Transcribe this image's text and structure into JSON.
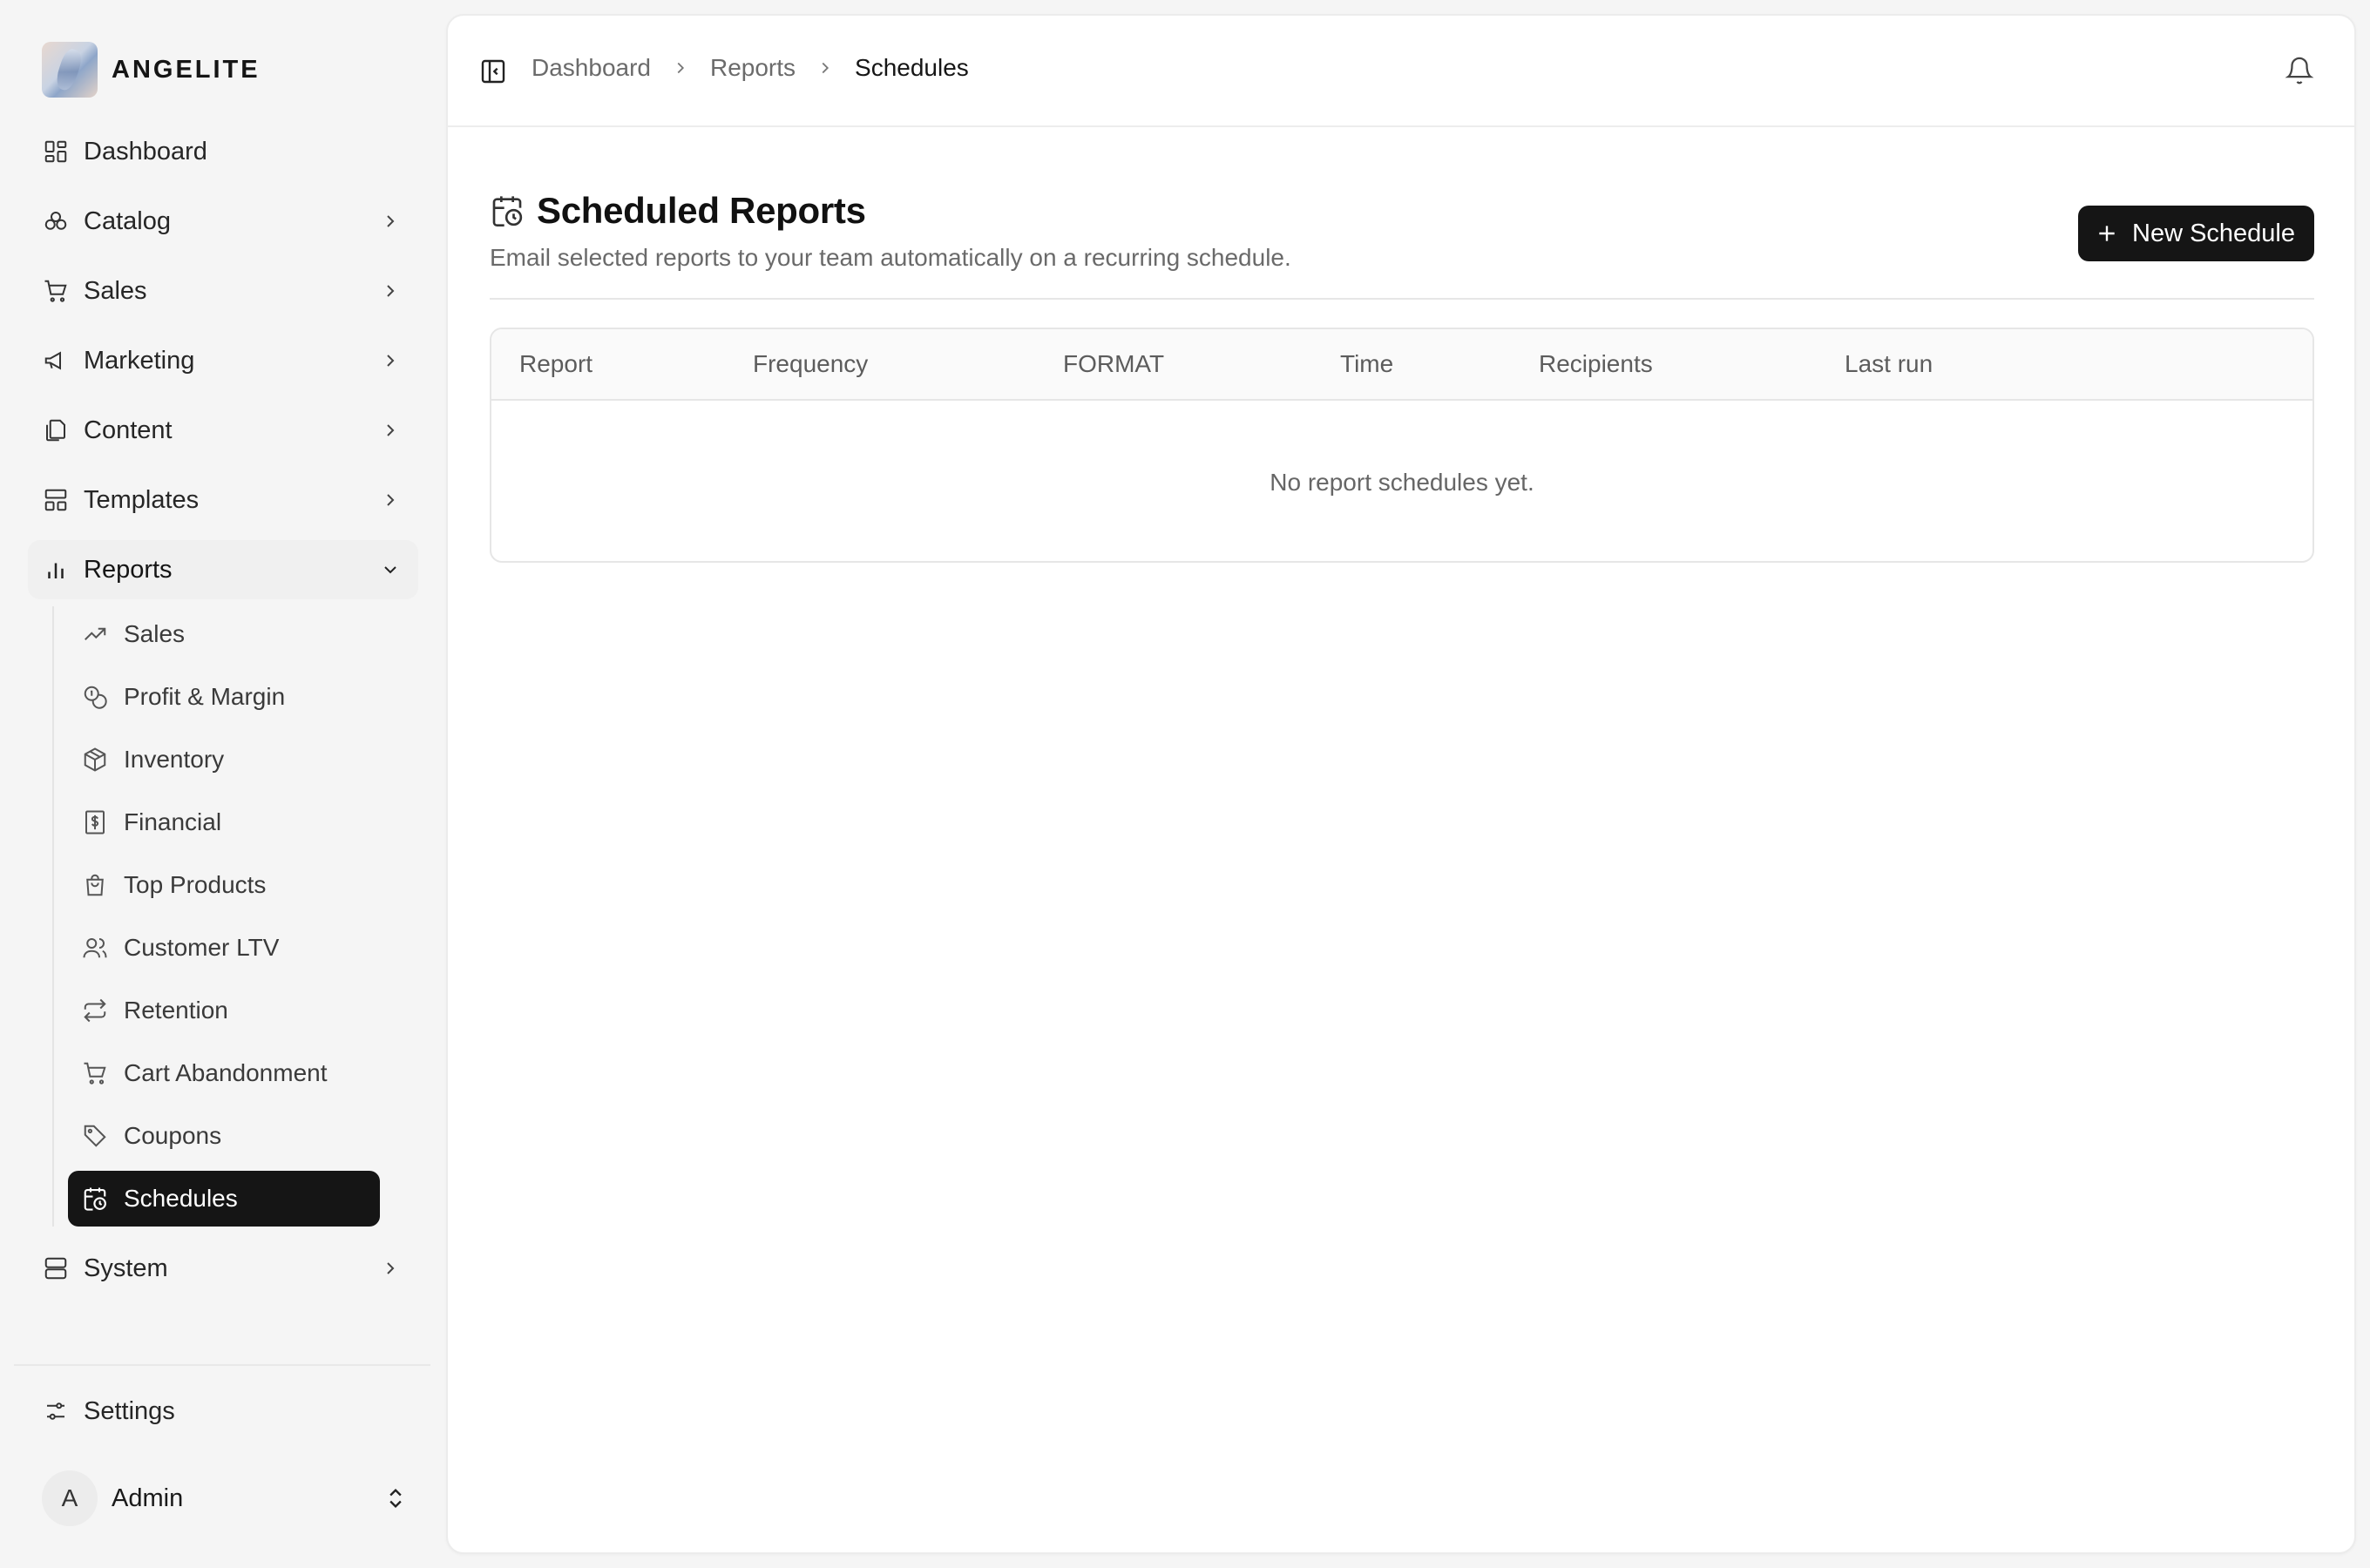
{
  "brand": {
    "name": "ANGELITE"
  },
  "sidebar": {
    "items": [
      {
        "label": "Dashboard",
        "icon": "dashboard-icon",
        "has_chevron": false
      },
      {
        "label": "Catalog",
        "icon": "catalog-icon",
        "has_chevron": true
      },
      {
        "label": "Sales",
        "icon": "cart-icon",
        "has_chevron": true
      },
      {
        "label": "Marketing",
        "icon": "megaphone-icon",
        "has_chevron": true
      },
      {
        "label": "Content",
        "icon": "files-icon",
        "has_chevron": true
      },
      {
        "label": "Templates",
        "icon": "layout-icon",
        "has_chevron": true
      },
      {
        "label": "Reports",
        "icon": "bar-chart-icon",
        "expanded": true
      }
    ],
    "reports_sub": [
      {
        "label": "Sales",
        "icon": "trend-up-icon"
      },
      {
        "label": "Profit & Margin",
        "icon": "coins-icon"
      },
      {
        "label": "Inventory",
        "icon": "package-icon"
      },
      {
        "label": "Financial",
        "icon": "receipt-dollar-icon"
      },
      {
        "label": "Top Products",
        "icon": "shopping-bag-icon"
      },
      {
        "label": "Customer LTV",
        "icon": "users-icon"
      },
      {
        "label": "Retention",
        "icon": "repeat-icon"
      },
      {
        "label": "Cart Abandonment",
        "icon": "cart-icon"
      },
      {
        "label": "Coupons",
        "icon": "tag-icon"
      },
      {
        "label": "Schedules",
        "icon": "calendar-clock-icon",
        "active": true
      }
    ],
    "system": {
      "label": "System",
      "icon": "server-icon"
    },
    "settings": {
      "label": "Settings",
      "icon": "sliders-icon"
    },
    "user": {
      "initial": "A",
      "name": "Admin"
    }
  },
  "breadcrumb": [
    "Dashboard",
    "Reports",
    "Schedules"
  ],
  "page": {
    "title": "Scheduled Reports",
    "subtitle": "Email selected reports to your team automatically on a recurring schedule.",
    "new_button": "New Schedule"
  },
  "table": {
    "columns": [
      "Report",
      "Frequency",
      "FORMAT",
      "Time",
      "Recipients",
      "Last run"
    ],
    "empty_text": "No report schedules yet."
  },
  "colors": {
    "active_bg": "#151515",
    "button_bg": "#151515",
    "open_group_bg": "#f0f0f0"
  }
}
